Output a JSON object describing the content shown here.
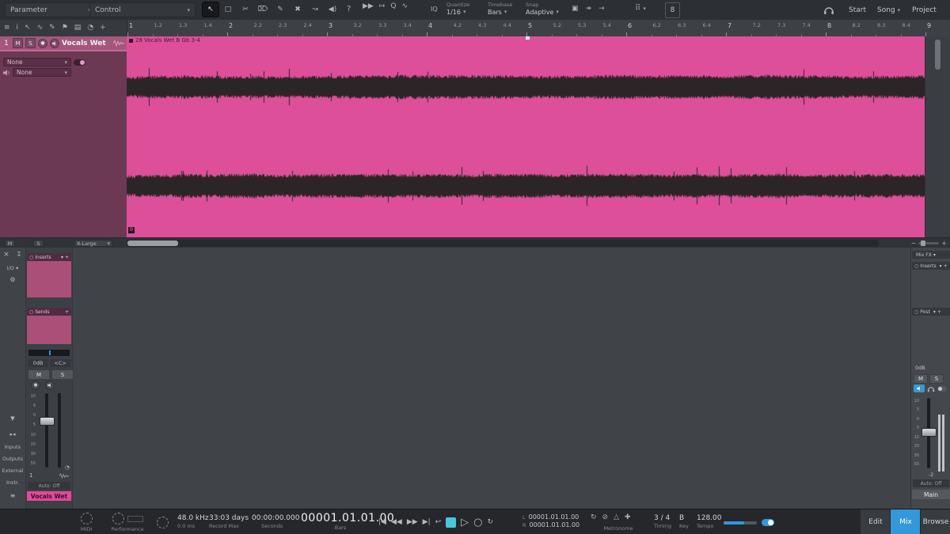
{
  "colors": {
    "accent_blue": "#3398d8",
    "stop_teal": "#45c8dc",
    "clip_pink": "#de4f9a",
    "waveform": "#2b2527",
    "track_maroon": "#6b3a52",
    "inserts_pink": "#aa5078",
    "label_pink": "#e2489b"
  },
  "top_toolbar": {
    "parameter_label": "Parameter",
    "control_label": "Control",
    "help": "?",
    "iq": "IQ",
    "quantize": {
      "label": "Quantize",
      "value": "1/16"
    },
    "timebase": {
      "label": "Timebase",
      "value": "Bars"
    },
    "snap": {
      "label": "Snap",
      "value": "Adaptive"
    },
    "macro": "8",
    "start": "Start",
    "song": "Song",
    "project": "Project"
  },
  "ruler": {
    "ticks": [
      "1",
      "1.2",
      "1.3",
      "1.4",
      "2",
      "2.2",
      "2.3",
      "2.4",
      "3",
      "3.2",
      "3.3",
      "3.4",
      "4",
      "4.2",
      "4.3",
      "4.4",
      "5",
      "5.2",
      "5.3",
      "5.4",
      "6",
      "6.2",
      "6.3",
      "6.4",
      "7",
      "7.2",
      "7.3",
      "7.4",
      "8",
      "8.2",
      "8.3",
      "8.4",
      "9"
    ]
  },
  "track_panel": {
    "number": "1",
    "mute": "M",
    "solo": "S",
    "name": "Vocals Wet",
    "insert_value": "None",
    "cue_value": "None"
  },
  "clip": {
    "title": "28 Vocals Wet B Gb 3-4",
    "gain_badge": "0"
  },
  "editor_footer": {
    "mute": "M",
    "solo": "S",
    "zoom_preset": "X-Large"
  },
  "console": {
    "left_bar": {
      "close": "×",
      "io": "I/O",
      "inputs": "Inputs",
      "outputs": "Outputs",
      "external": "External",
      "instr": "Instr."
    },
    "channel": {
      "inserts_label": "Inserts",
      "sends_label": "Sends",
      "gain": "0dB",
      "pan": "<C>",
      "mute": "M",
      "solo": "S",
      "fader_scale": [
        "10",
        "5",
        "0",
        "5",
        "10",
        "20",
        "30",
        "50"
      ],
      "number": "1",
      "auto": "Auto: Off",
      "name": "Vocals Wet"
    },
    "main": {
      "mixfx_label": "Mix FX",
      "inserts_label": "Inserts",
      "post_label": "Post",
      "gain": "0dB",
      "mute": "M",
      "solo": "S",
      "peak": "-2",
      "auto": "Auto: Off",
      "name": "Main"
    }
  },
  "transport": {
    "midi_label": "MIDI",
    "performance_label": "Performance",
    "sample_rate": "48.0 kHz",
    "latency": "0.0 ms",
    "record_max_value": "33:03 days",
    "record_max_label": "Record Max",
    "time_value": "00:00:00.000",
    "time_label": "Seconds",
    "bars_value": "00001.01.01.00",
    "bars_label": "Bars",
    "loop_l_label": "L",
    "loop_l": "00001.01.01.00",
    "loop_r_label": "R",
    "loop_r": "00001.01.01.00",
    "metronome_label": "Metronome",
    "timing_value": "3 / 4",
    "timing_label": "Timing",
    "key_value": "B",
    "key_label": "Key",
    "tempo_value": "128.00",
    "tempo_label": "Tempo",
    "edit": "Edit",
    "mix": "Mix",
    "browse": "Browse"
  },
  "waveform": {
    "seed": 11,
    "bands": [
      64,
      189
    ]
  },
  "icons": {
    "editbar": [
      {
        "name": "menu-icon",
        "glyph": "≡"
      },
      {
        "name": "info-icon",
        "glyph": "i"
      },
      {
        "name": "cursor-icon",
        "glyph": "↖"
      },
      {
        "name": "curve-icon",
        "glyph": "∿"
      },
      {
        "name": "pencil-icon",
        "glyph": "✎"
      },
      {
        "name": "marker-icon",
        "glyph": "⚑"
      },
      {
        "name": "layers-icon",
        "glyph": "▤"
      },
      {
        "name": "timer-icon",
        "glyph": "◔"
      },
      {
        "name": "add-icon",
        "glyph": "+"
      }
    ],
    "tools": [
      {
        "name": "arrow-tool",
        "glyph": "↖",
        "cls": "sel"
      },
      {
        "name": "range-tool",
        "glyph": "□"
      },
      {
        "name": "split-tool",
        "glyph": "✂"
      },
      {
        "name": "eraser-tool",
        "glyph": "⌦"
      },
      {
        "name": "paint-tool",
        "glyph": "✎"
      },
      {
        "name": "mute-tool",
        "glyph": "✖"
      },
      {
        "name": "bend-tool",
        "glyph": "↝"
      },
      {
        "name": "listen-tool",
        "glyph": "◀)"
      }
    ],
    "play_group": [
      {
        "name": "play-overlap-icon",
        "glyph": "▶▶"
      },
      {
        "name": "autoscroll-icon",
        "glyph": "↦"
      },
      {
        "name": "zoom-icon",
        "glyph": "Q"
      },
      {
        "name": "swing-icon",
        "glyph": "∿"
      }
    ],
    "snap_group": [
      {
        "name": "snap-mode-icon",
        "glyph": "▣"
      },
      {
        "name": "follow-icon",
        "glyph": "↠"
      },
      {
        "name": "arrow-right-icon",
        "glyph": "→"
      }
    ],
    "grid_icon": "⠿",
    "transport_buttons": [
      {
        "name": "goto-start-button",
        "glyph": "|◀"
      },
      {
        "name": "rewind-button",
        "glyph": "◀◀"
      },
      {
        "name": "forward-button",
        "glyph": "▶▶"
      },
      {
        "name": "goto-end-button",
        "glyph": "▶|"
      },
      {
        "name": "return-button",
        "glyph": "↩"
      },
      {
        "name": "stop-button",
        "glyph": "",
        "cls": "stop"
      },
      {
        "name": "play-button",
        "glyph": "▷",
        "cls": "big"
      },
      {
        "name": "record-button",
        "glyph": "○",
        "cls": "big"
      },
      {
        "name": "loop-button",
        "glyph": "↻"
      }
    ],
    "metronome_group": [
      {
        "name": "preroll-icon",
        "glyph": "↻"
      },
      {
        "name": "autopunch-icon",
        "glyph": "⊘"
      },
      {
        "name": "metronome-icon",
        "glyph": "△"
      },
      {
        "name": "precount-icon",
        "glyph": "✚"
      }
    ]
  }
}
